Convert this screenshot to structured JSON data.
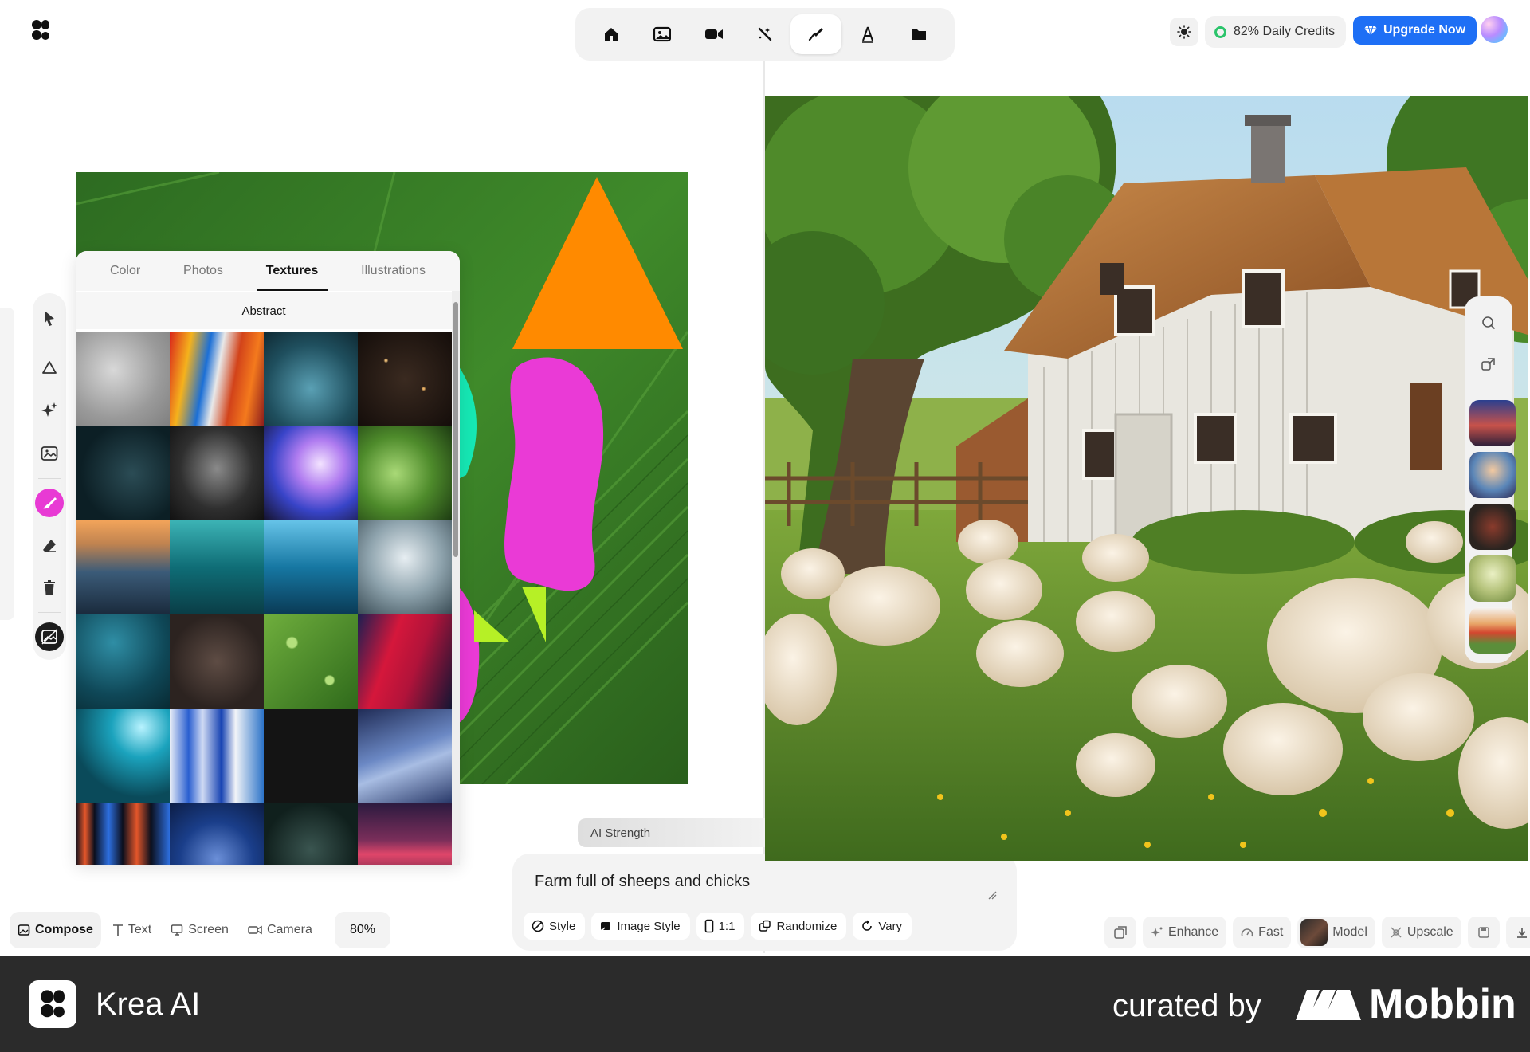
{
  "app": {
    "logo_icon": "krea-logo-icon"
  },
  "toolbar": {
    "tools": [
      {
        "icon": "home-icon",
        "active": false
      },
      {
        "icon": "image-icon",
        "active": false
      },
      {
        "icon": "video-camera-icon",
        "active": false
      },
      {
        "icon": "magic-wand-icon",
        "active": false
      },
      {
        "icon": "brush-icon",
        "active": true
      },
      {
        "icon": "text-font-icon",
        "active": false
      },
      {
        "icon": "folder-icon",
        "active": false
      }
    ]
  },
  "header": {
    "credits_label": "82% Daily Credits",
    "upgrade_label": "Upgrade Now",
    "accent_color": "#1e6ff5",
    "credits_color": "#2bc46b"
  },
  "texture_panel": {
    "tabs": [
      "Color",
      "Photos",
      "Textures",
      "Illustrations"
    ],
    "active_tab": "Textures",
    "category": "Abstract"
  },
  "ai_strength": {
    "label": "AI Strength"
  },
  "prompt": {
    "text": "Farm full of sheeps and chicks",
    "chips": [
      "Style",
      "Image Style",
      "1:1",
      "Randomize",
      "Vary"
    ]
  },
  "modes": {
    "items": [
      "Compose",
      "Text",
      "Screen",
      "Camera"
    ],
    "active": "Compose",
    "zoom": "80%"
  },
  "actions": {
    "enhance": "Enhance",
    "fast": "Fast",
    "model": "Model",
    "upscale": "Upscale"
  },
  "footer": {
    "app_name": "Krea AI",
    "curated_by": "curated by",
    "brand": "Mobbin"
  }
}
